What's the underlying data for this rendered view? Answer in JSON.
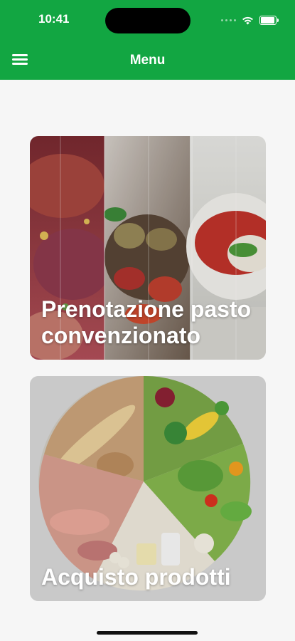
{
  "status_bar": {
    "time": "10:41",
    "battery_level": 0.95
  },
  "header": {
    "title": "Menu",
    "menu_icon": "hamburger-menu-icon",
    "background": "#12a642"
  },
  "cards": [
    {
      "label": "Prenotazione pasto convenzionato",
      "image": "meal-dishes-photo"
    },
    {
      "label": "Acquisto prodotti",
      "image": "food-groups-photo"
    }
  ]
}
